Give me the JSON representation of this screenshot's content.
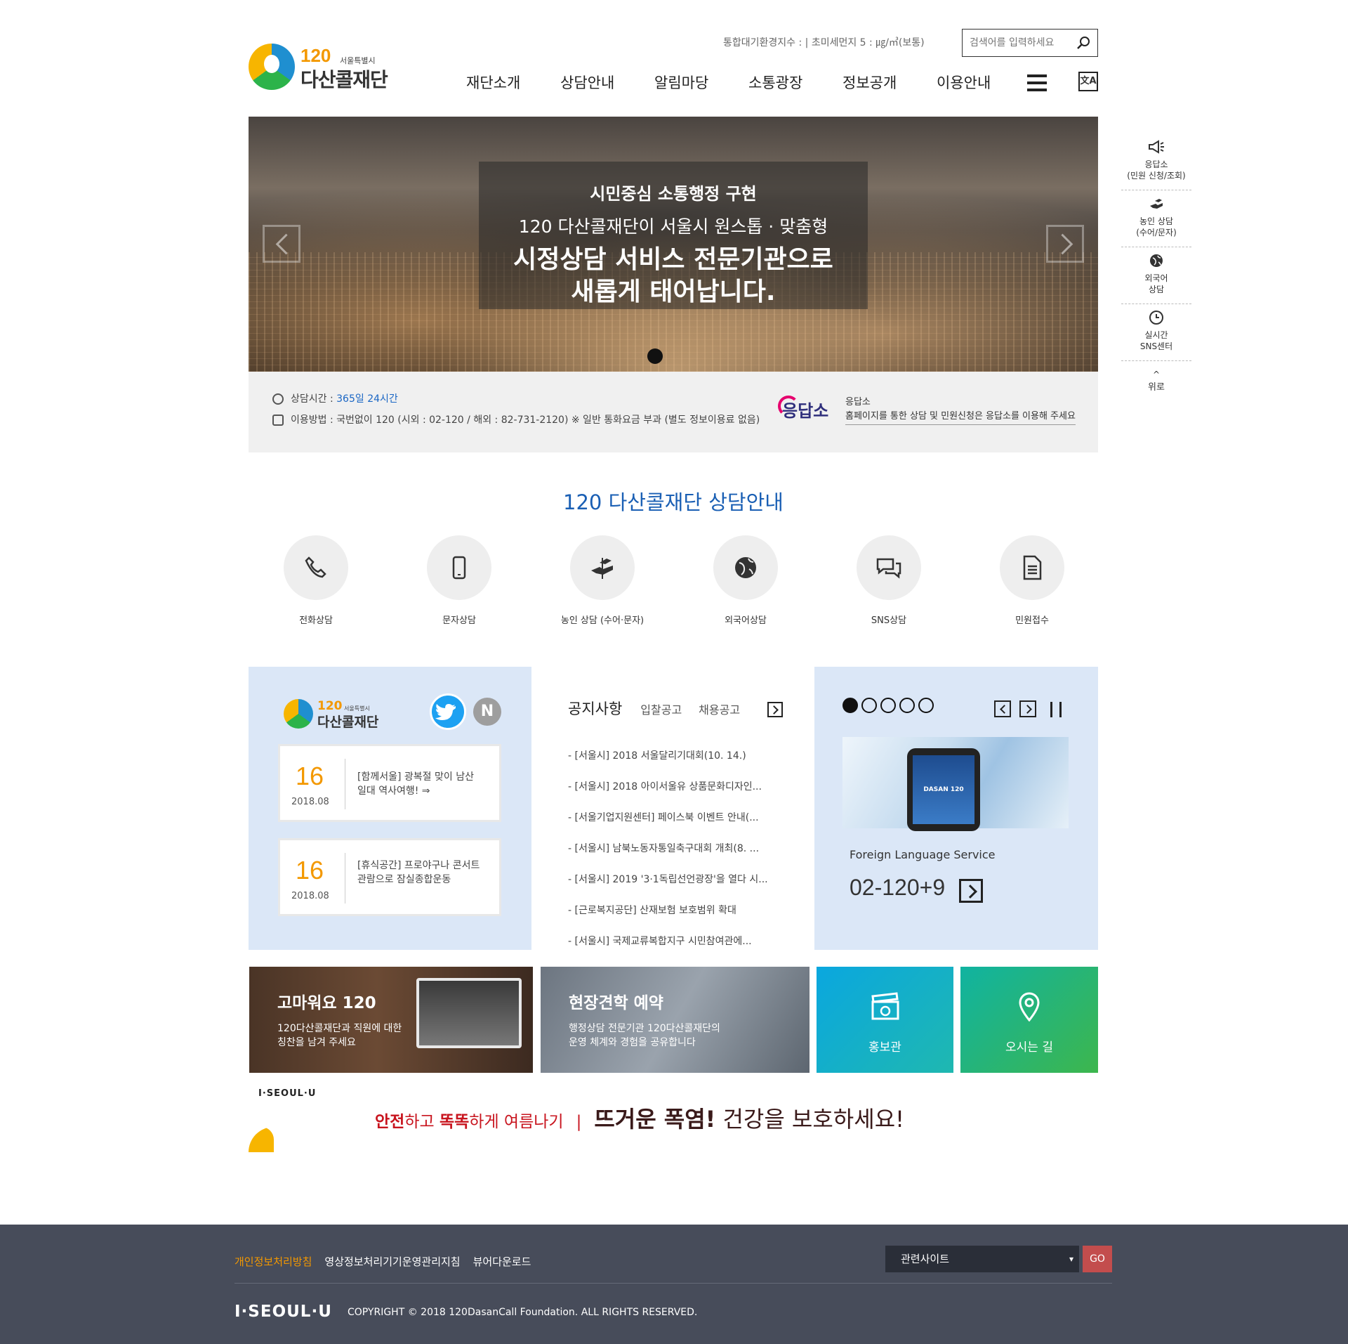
{
  "header": {
    "logo": {
      "number": "120",
      "city": "서울특별시",
      "name": "다산콜재단"
    },
    "air_quality": "통합대기환경지수 : | 초미세먼지 5 : ㎍/㎥(보통)",
    "search_placeholder": "검색어를 입력하세요",
    "nav": [
      "재단소개",
      "상담안내",
      "알림마당",
      "소통광장",
      "정보공개",
      "이용안내"
    ],
    "lang_label": "文A"
  },
  "hero": {
    "line1": "시민중심 소통행정 구현",
    "line2": "120 다산콜재단이 서울시 원스톱 · 맞춤형",
    "line3": "시정상담 서비스 전문기관으로",
    "line4": "새롭게 태어납니다."
  },
  "info": {
    "hours_label": "상담시간 : ",
    "hours_value": "365일 24시간",
    "method": "이용방법 : 국번없이 120 (시외 : 02-120 / 해외 : 82-731-2120) ※ 일반 통화요금 부과 (별도 정보이용료 없음)",
    "eungdap_logo": "응답소",
    "eungdap_title": "응답소",
    "eungdap_desc": "홈페이지를 통한 상담 및 민원신청은 응답소를 이용해 주세요"
  },
  "quick": [
    {
      "label1": "응답소",
      "label2": "(민원 신청/조회)",
      "icon": "megaphone-icon"
    },
    {
      "label1": "농인 상담",
      "label2": "(수어/문자)",
      "icon": "sign-language-icon"
    },
    {
      "label1": "외국어",
      "label2": "상담",
      "icon": "globe-icon"
    },
    {
      "label1": "실시간",
      "label2": "SNS센터",
      "icon": "clock-icon"
    }
  ],
  "quick_top": "위로",
  "counsel": {
    "title": "120 다산콜재단 상담안내",
    "services": [
      "전화상담",
      "문자상담",
      "농인 상담 (수어·문자)",
      "외국어상담",
      "SNS상담",
      "민원접수"
    ]
  },
  "sns": {
    "logo_number": "120",
    "logo_city": "서울특별시",
    "logo_name": "다산콜재단",
    "naver": "N",
    "cards": [
      {
        "day": "16",
        "ym": "2018.08",
        "text": "[함께서울] 광복절 맞이 남산 일대 역사여행! ⇒"
      },
      {
        "day": "16",
        "ym": "2018.08",
        "text": "[휴식공간] 프로야구나 콘서트 관람으로 잠실종합운동"
      }
    ]
  },
  "notice": {
    "tabs": [
      "공지사항",
      "입찰공고",
      "채용공고"
    ],
    "items": [
      "- [서울시] 2018 서울달리기대회(10. 14.)",
      "- [서울시] 2018 아이서울유 상품문화디자인...",
      "- [서울기업지원센터] 페이스북 이벤트 안내(...",
      "- [서울시] 남북노동자통일축구대회 개최(8. ...",
      "- [서울시] 2019 '3·1독립선언광장'을 열다 시...",
      "- [근로복지공단] 산재보험 보호범위 확대",
      "- [서울시] 국제교류복합지구 시민참여관에..."
    ]
  },
  "slider": {
    "active_index": 0,
    "count": 5,
    "phone_text": "DASAN 120",
    "caption": "Foreign Language Service",
    "tel": "02-120+9"
  },
  "banners": {
    "b1_title": "고마워요 120",
    "b1_desc1": "120다산콜재단과 직원에 대한",
    "b1_desc2": "칭찬을 남겨 주세요",
    "b2_title": "현장견학 예약",
    "b2_desc1": "행정상담 전문기관 120다산콜재단의",
    "b2_desc2": "운영 체계와 경험을 공유합니다",
    "b3_label": "홍보관",
    "b4_label": "오시는 길"
  },
  "campaign": {
    "brand": "I·SEOUL·U",
    "p1": "안전",
    "p2": "하고 ",
    "p3": "똑똑",
    "p4": "하게 여름나기",
    "sep": "|",
    "big": "뜨거운 폭염!",
    "rest": " 건강을 보호하세요!"
  },
  "footer": {
    "links": [
      "개인정보처리방침",
      "영상정보처리기기운영관리지침",
      "뷰어다운로드"
    ],
    "select": "관련사이트",
    "go": "GO",
    "logo": "I·SEOUL·U",
    "copyright": "COPYRIGHT © 2018 120DasanCall Foundation. ALL RIGHTS RESERVED."
  },
  "colors": {
    "brand_blue": "#1a5fb4",
    "brand_orange": "#f39800",
    "footer_bg": "#474c5a",
    "panel_blue": "#dbe7f7"
  }
}
